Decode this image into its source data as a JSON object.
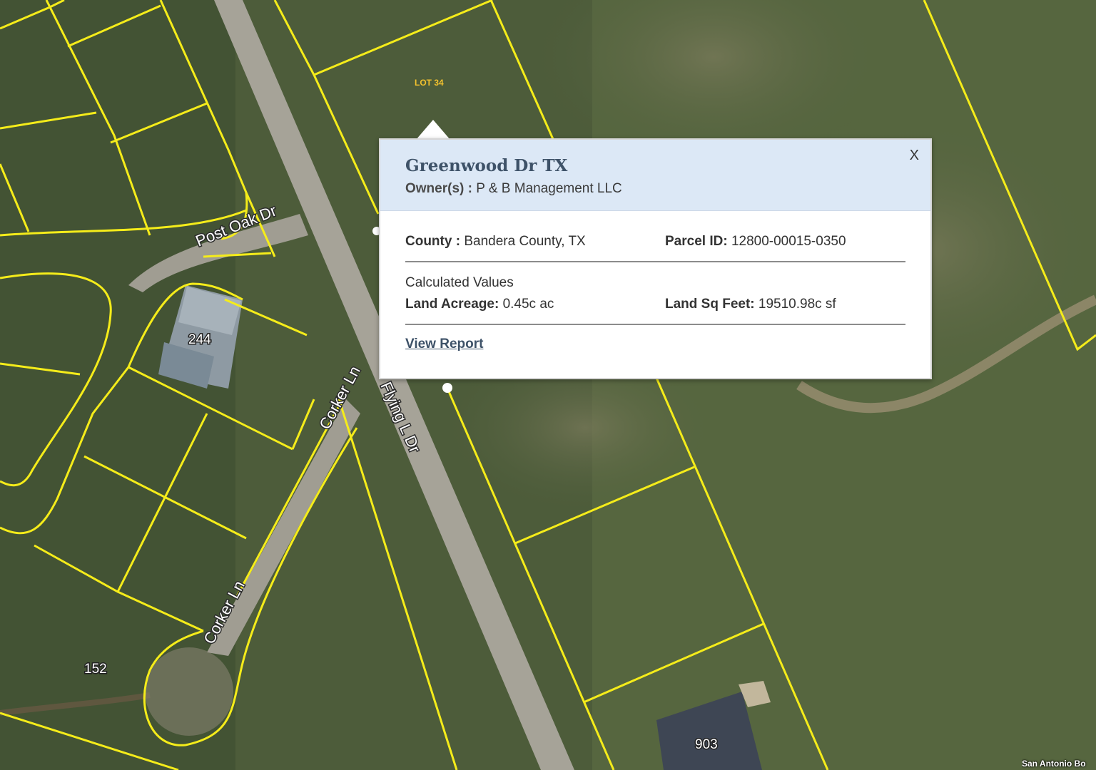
{
  "map": {
    "road_labels": {
      "post_oak": "Post Oak Dr",
      "corker_upper": "Corker Ln",
      "corker_lower": "Corker Ln",
      "flying_l": "Flying L Dr"
    },
    "house_numbers": [
      "244",
      "152",
      "903"
    ],
    "lot_label": "LOT 34",
    "attribution": "San Antonio Bo",
    "colors": {
      "parcel_line": "#f5ec1a",
      "grass": "#4f5e3c",
      "road": "#a8a59c"
    }
  },
  "popup": {
    "title": "Greenwood Dr TX",
    "owner_label": "Owner(s) :",
    "owner_value": "P & B Management LLC",
    "close_label": "X",
    "county_label": "County :",
    "county_value": "Bandera County, TX",
    "parcel_label": "Parcel ID:",
    "parcel_value": "12800-00015-0350",
    "calc_heading": "Calculated Values",
    "acreage_label": "Land Acreage:",
    "acreage_value": "0.45c ac",
    "sqft_label": "Land Sq Feet:",
    "sqft_value": "19510.98c sf",
    "report_link": "View Report"
  }
}
